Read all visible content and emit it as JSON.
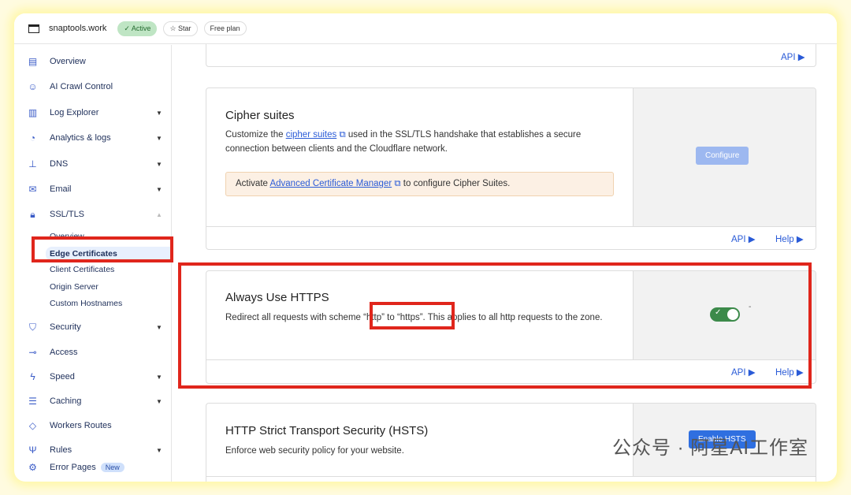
{
  "header": {
    "site": "snaptools.work",
    "status": "Active",
    "star": "Star",
    "plan": "Free plan"
  },
  "sidebar": {
    "items": [
      {
        "label": "Overview",
        "icon": "clipboard-icon"
      },
      {
        "label": "AI Crawl Control",
        "icon": "robot-icon"
      },
      {
        "label": "Log Explorer",
        "icon": "log-icon"
      },
      {
        "label": "Analytics & logs",
        "icon": "chart-icon"
      },
      {
        "label": "DNS",
        "icon": "network-icon"
      },
      {
        "label": "Email",
        "icon": "email-icon"
      },
      {
        "label": "SSL/TLS",
        "icon": "lock-icon"
      },
      {
        "label": "Security",
        "icon": "shield-icon"
      },
      {
        "label": "Access",
        "icon": "access-icon"
      },
      {
        "label": "Speed",
        "icon": "bolt-icon"
      },
      {
        "label": "Caching",
        "icon": "caching-icon"
      },
      {
        "label": "Workers Routes",
        "icon": "workers-icon"
      },
      {
        "label": "Rules",
        "icon": "rules-icon"
      },
      {
        "label": "Error Pages",
        "icon": "error-pages-icon",
        "badge": "New"
      }
    ],
    "ssl_sub": [
      "Overview",
      "Edge Certificates",
      "Client Certificates",
      "Origin Server",
      "Custom Hostnames"
    ]
  },
  "main": {
    "api": "API",
    "help": "Help",
    "cipher": {
      "title": "Cipher suites",
      "desc_pre": "Customize the ",
      "desc_link": "cipher suites",
      "desc_post": " used in the SSL/TLS handshake that establishes a secure connection between clients and the Cloudflare network.",
      "notice_pre": "Activate ",
      "notice_link": "Advanced Certificate Manager",
      "notice_post": " to configure Cipher Suites.",
      "button": "Configure"
    },
    "https": {
      "title": "Always Use HTTPS",
      "desc": "Redirect all requests with scheme “http” to “https”. This applies to all http requests to the zone.",
      "toggle_on": true,
      "toggle_note": "-"
    },
    "hsts": {
      "title": "HTTP Strict Transport Security (HSTS)",
      "desc": "Enforce web security policy for your website.",
      "button": "Enable HSTS"
    }
  },
  "watermark": "公众号 · 阿星AI工作室",
  "colors": {
    "accent": "#2a5bd7",
    "highlight": "#e0261c",
    "toggle": "#3c8a4a"
  }
}
